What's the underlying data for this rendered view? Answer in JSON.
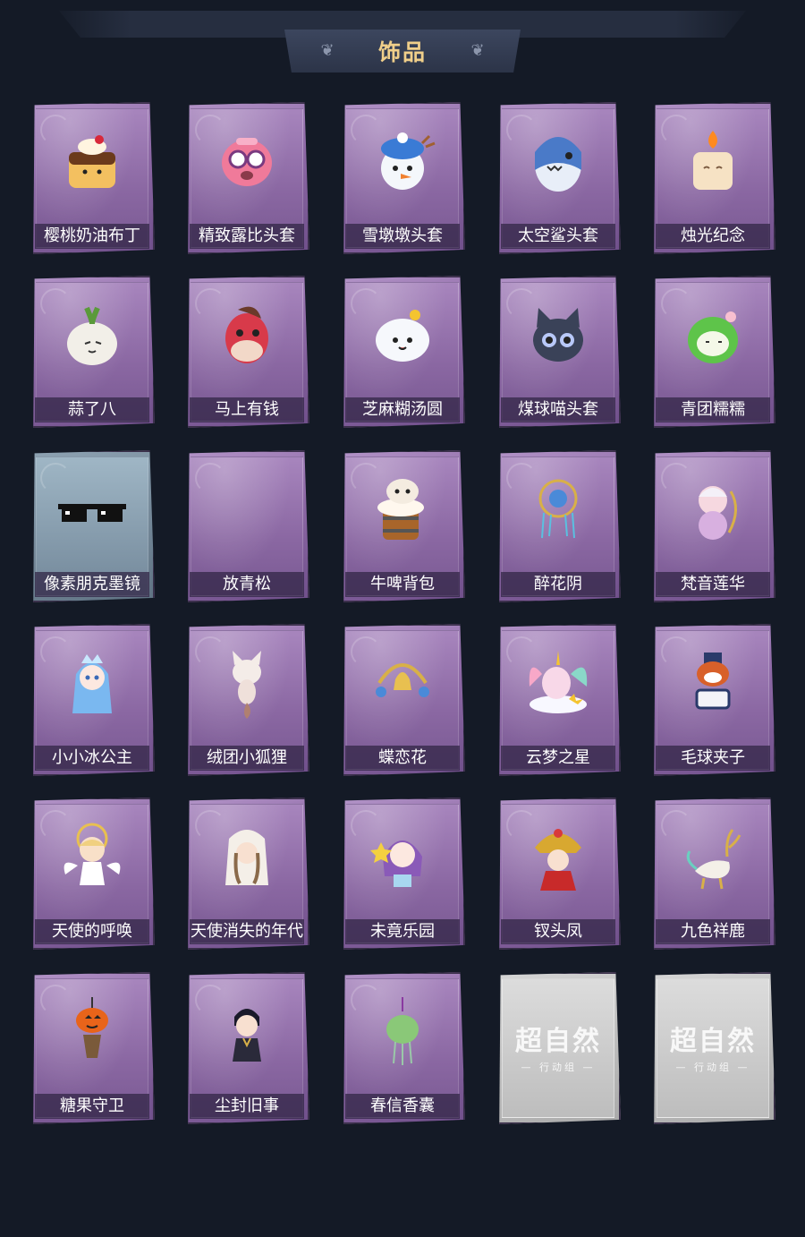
{
  "header": {
    "title": "饰品"
  },
  "watermark": {
    "title": "超自然",
    "subtitle": "— 行动组 —"
  },
  "items": [
    {
      "name": "樱桃奶油布丁",
      "icon": "pudding-icon",
      "variant": "purple"
    },
    {
      "name": "精致露比头套",
      "icon": "pink-creature-icon",
      "variant": "purple"
    },
    {
      "name": "雪墩墩头套",
      "icon": "snow-head-icon",
      "variant": "purple"
    },
    {
      "name": "太空鲨头套",
      "icon": "shark-head-icon",
      "variant": "purple"
    },
    {
      "name": "烛光纪念",
      "icon": "candle-icon",
      "variant": "purple"
    },
    {
      "name": "蒜了八",
      "icon": "garlic-icon",
      "variant": "purple"
    },
    {
      "name": "马上有钱",
      "icon": "horse-head-icon",
      "variant": "purple"
    },
    {
      "name": "芝麻糊汤圆",
      "icon": "dumpling-icon",
      "variant": "purple"
    },
    {
      "name": "煤球喵头套",
      "icon": "cat-head-icon",
      "variant": "purple"
    },
    {
      "name": "青团糯糯",
      "icon": "green-rice-ball-icon",
      "variant": "purple"
    },
    {
      "name": "像素朋克墨镜",
      "icon": "pixel-sunglasses-icon",
      "variant": "blue"
    },
    {
      "name": "放青松",
      "icon": "empty-icon",
      "variant": "purple"
    },
    {
      "name": "牛啤背包",
      "icon": "cow-beer-backpack-icon",
      "variant": "purple"
    },
    {
      "name": "醉花阴",
      "icon": "flower-ornament-icon",
      "variant": "purple"
    },
    {
      "name": "梵音莲华",
      "icon": "lotus-doll-icon",
      "variant": "purple"
    },
    {
      "name": "小小冰公主",
      "icon": "ice-princess-icon",
      "variant": "purple"
    },
    {
      "name": "绒团小狐狸",
      "icon": "fox-icon",
      "variant": "purple"
    },
    {
      "name": "蝶恋花",
      "icon": "bell-ornament-icon",
      "variant": "purple"
    },
    {
      "name": "云梦之星",
      "icon": "unicorn-icon",
      "variant": "purple"
    },
    {
      "name": "毛球夹子",
      "icon": "raccoon-drummer-icon",
      "variant": "purple"
    },
    {
      "name": "天使的呼唤",
      "icon": "angel-icon",
      "variant": "purple"
    },
    {
      "name": "天使消失的年代",
      "icon": "veiled-girl-icon",
      "variant": "purple"
    },
    {
      "name": "未竟乐园",
      "icon": "star-doll-icon",
      "variant": "purple"
    },
    {
      "name": "钗头凤",
      "icon": "phoenix-crown-icon",
      "variant": "purple"
    },
    {
      "name": "九色祥鹿",
      "icon": "deer-icon",
      "variant": "purple"
    },
    {
      "name": "糖果守卫",
      "icon": "pumpkin-icon",
      "variant": "purple"
    },
    {
      "name": "尘封旧事",
      "icon": "dark-boy-icon",
      "variant": "purple"
    },
    {
      "name": "春信香囊",
      "icon": "sachet-icon",
      "variant": "purple"
    },
    {
      "name": "",
      "icon": "placeholder-logo-icon",
      "variant": "gray"
    },
    {
      "name": "",
      "icon": "placeholder-logo-icon",
      "variant": "gray"
    }
  ],
  "colors": {
    "background": "#141a26",
    "title_gold": "#f0cf8a",
    "card_purple": "#9a78b2",
    "card_blue": "#8ea3b3",
    "card_gray": "#cfcfcf"
  }
}
